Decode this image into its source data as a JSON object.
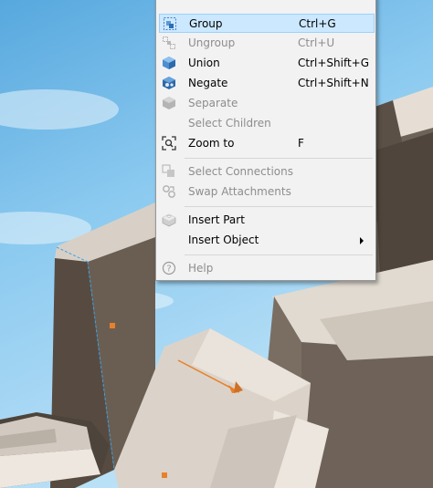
{
  "context_menu": {
    "items": [
      {
        "label": "Group",
        "shortcut": "Ctrl+G",
        "icon": "group-icon",
        "enabled": true,
        "highlighted": true
      },
      {
        "label": "Ungroup",
        "shortcut": "Ctrl+U",
        "icon": "ungroup-icon",
        "enabled": false
      },
      {
        "label": "Union",
        "shortcut": "Ctrl+Shift+G",
        "icon": "union-icon",
        "enabled": true
      },
      {
        "label": "Negate",
        "shortcut": "Ctrl+Shift+N",
        "icon": "negate-icon",
        "enabled": true
      },
      {
        "label": "Separate",
        "shortcut": "",
        "icon": "separate-icon",
        "enabled": false
      },
      {
        "label": "Select Children",
        "shortcut": "",
        "icon": "",
        "enabled": false
      },
      {
        "label": "Zoom to",
        "shortcut": "F",
        "icon": "zoom-to-icon",
        "enabled": true
      },
      {
        "label": "Select Connections",
        "shortcut": "",
        "icon": "select-connections-icon",
        "enabled": false
      },
      {
        "label": "Swap Attachments",
        "shortcut": "",
        "icon": "swap-attachments-icon",
        "enabled": false
      },
      {
        "label": "Insert Part",
        "shortcut": "",
        "icon": "insert-part-icon",
        "enabled": true
      },
      {
        "label": "Insert Object",
        "shortcut": "",
        "icon": "",
        "enabled": true,
        "submenu": true
      },
      {
        "label": "Help",
        "shortcut": "",
        "icon": "help-icon",
        "enabled": false
      }
    ]
  },
  "colors": {
    "menu_bg": "#f2f2f2",
    "highlight_bg": "#cce8ff",
    "highlight_border": "#99d1ff",
    "disabled_text": "#8d8d8d",
    "sky": "#6cb5e4",
    "part_dark": "#5e5247",
    "part_light": "#ded6cc",
    "selection_handle": "#e8802a"
  }
}
